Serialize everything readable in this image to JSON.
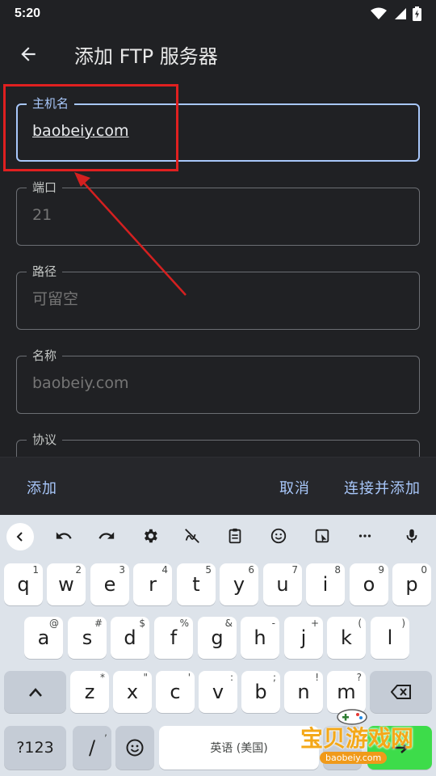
{
  "status_bar": {
    "time": "5:20"
  },
  "app_bar": {
    "title": "添加 FTP 服务器"
  },
  "form": {
    "host": {
      "label": "主机名",
      "value": "baobeiy.com",
      "placeholder": ""
    },
    "port": {
      "label": "端口",
      "value": "",
      "placeholder": "21"
    },
    "path": {
      "label": "路径",
      "value": "",
      "placeholder": "可留空"
    },
    "name": {
      "label": "名称",
      "value": "",
      "placeholder": "baobeiy.com"
    },
    "protocol": {
      "label": "协议"
    }
  },
  "actions": {
    "add": "添加",
    "cancel": "取消",
    "connect_add": "连接并添加"
  },
  "keyboard": {
    "row1": [
      {
        "key": "q",
        "hint": "1"
      },
      {
        "key": "w",
        "hint": "2"
      },
      {
        "key": "e",
        "hint": "3"
      },
      {
        "key": "r",
        "hint": "4"
      },
      {
        "key": "t",
        "hint": "5"
      },
      {
        "key": "y",
        "hint": "6"
      },
      {
        "key": "u",
        "hint": "7"
      },
      {
        "key": "i",
        "hint": "8"
      },
      {
        "key": "o",
        "hint": "9"
      },
      {
        "key": "p",
        "hint": "0"
      }
    ],
    "row2": [
      {
        "key": "a",
        "hint": "@"
      },
      {
        "key": "s",
        "hint": "#"
      },
      {
        "key": "d",
        "hint": "$"
      },
      {
        "key": "f",
        "hint": "%"
      },
      {
        "key": "g",
        "hint": "&"
      },
      {
        "key": "h",
        "hint": "-"
      },
      {
        "key": "j",
        "hint": "+"
      },
      {
        "key": "k",
        "hint": "("
      },
      {
        "key": "l",
        "hint": ")"
      }
    ],
    "row3": [
      {
        "key": "z",
        "hint": "*"
      },
      {
        "key": "x",
        "hint": "\""
      },
      {
        "key": "c",
        "hint": "'"
      },
      {
        "key": "v",
        "hint": ":"
      },
      {
        "key": "b",
        "hint": ";"
      },
      {
        "key": "n",
        "hint": "!"
      },
      {
        "key": "m",
        "hint": "?"
      }
    ],
    "symbols_key": "?123",
    "slash_key": "/",
    "slash_hint": ",",
    "space_label": "英语 (美国)"
  },
  "watermark": {
    "title": "宝贝游戏网",
    "url": "baobeiy.com"
  },
  "colors": {
    "accent": "#a8c7fa",
    "annotation": "#e02020",
    "background": "#202124"
  }
}
